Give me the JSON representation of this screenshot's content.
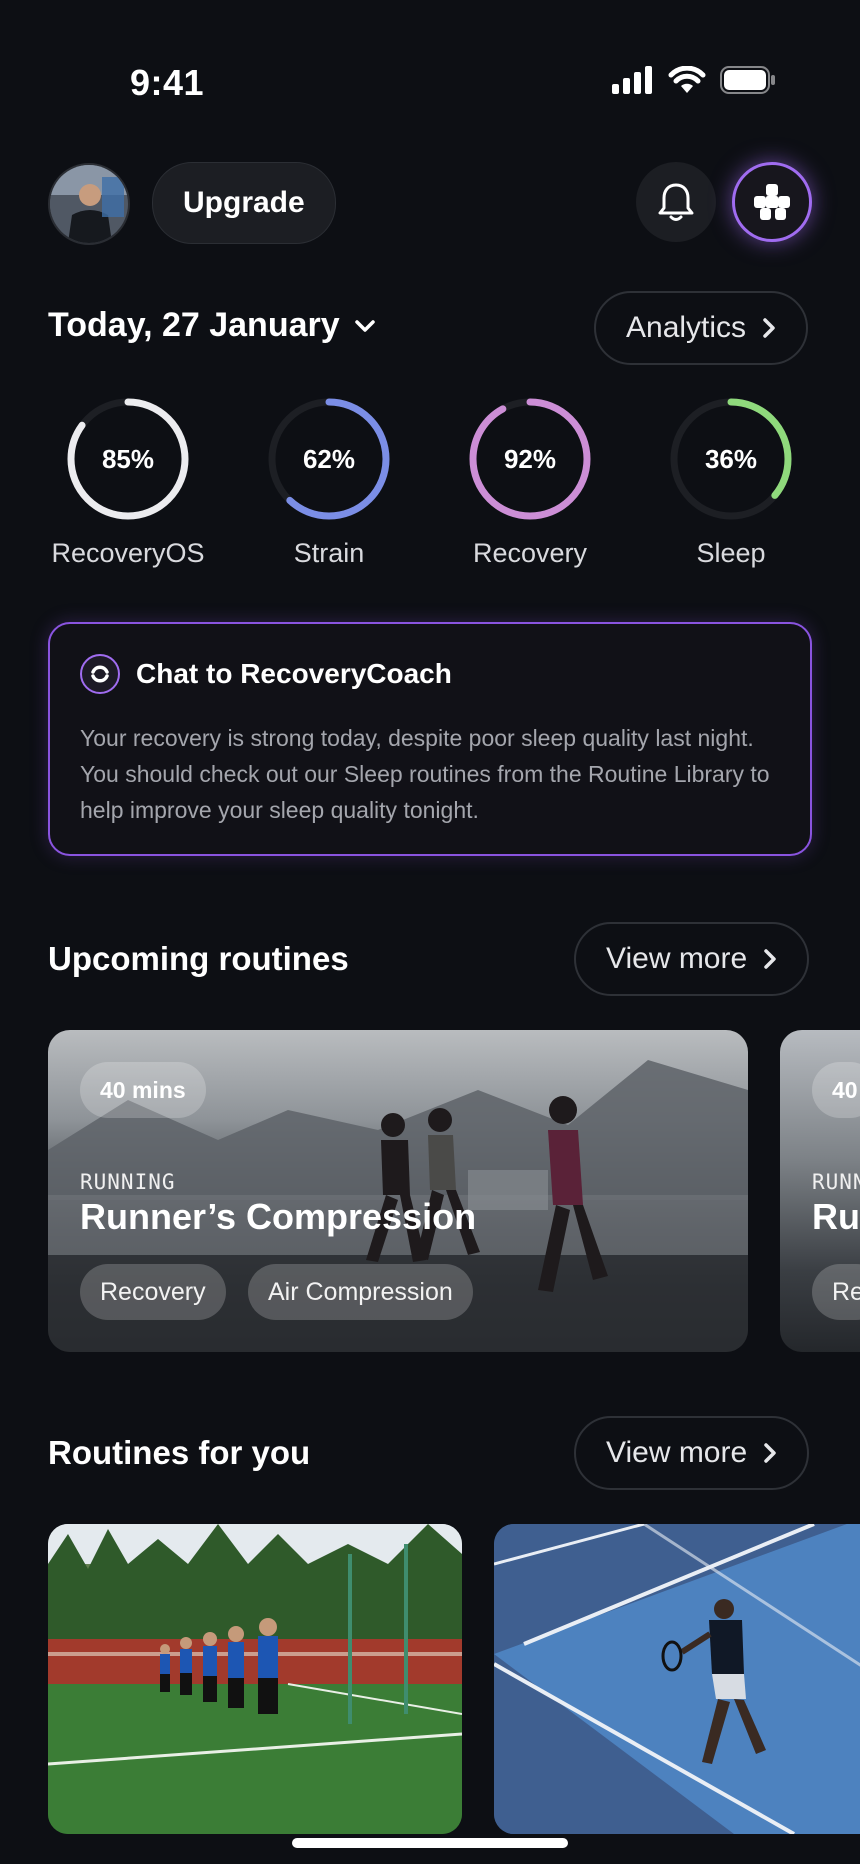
{
  "status_bar": {
    "time": "9:41"
  },
  "header": {
    "upgrade_label": "Upgrade"
  },
  "date_row": {
    "date": "Today, 27 January",
    "analytics_label": "Analytics"
  },
  "metrics": [
    {
      "value": "85%",
      "label": "RecoveryOS",
      "percent": 85,
      "color": "#ececef"
    },
    {
      "value": "62%",
      "label": "Strain",
      "percent": 62,
      "color": "#7b8ee6"
    },
    {
      "value": "92%",
      "label": "Recovery",
      "percent": 92,
      "color": "#cc8ed6"
    },
    {
      "value": "36%",
      "label": "Sleep",
      "percent": 36,
      "color": "#8fd97c"
    }
  ],
  "coach": {
    "title": "Chat to RecoveryCoach",
    "body": "Your recovery is strong today, despite poor sleep quality last night. You should check out our Sleep routines from the Routine Library to help improve your sleep quality tonight."
  },
  "upcoming": {
    "title": "Upcoming routines",
    "view_more": "View more",
    "cards": [
      {
        "duration": "40 mins",
        "category": "RUNNING",
        "title": "Runner’s Compression",
        "tags": [
          "Recovery",
          "Air Compression"
        ]
      },
      {
        "duration": "40",
        "category": "RUNN",
        "title": "Ru",
        "tags": [
          "Re"
        ]
      }
    ]
  },
  "for_you": {
    "title": "Routines for you",
    "view_more": "View more"
  },
  "colors": {
    "accent_purple": "#a06cf0",
    "background": "#0d0f14"
  }
}
